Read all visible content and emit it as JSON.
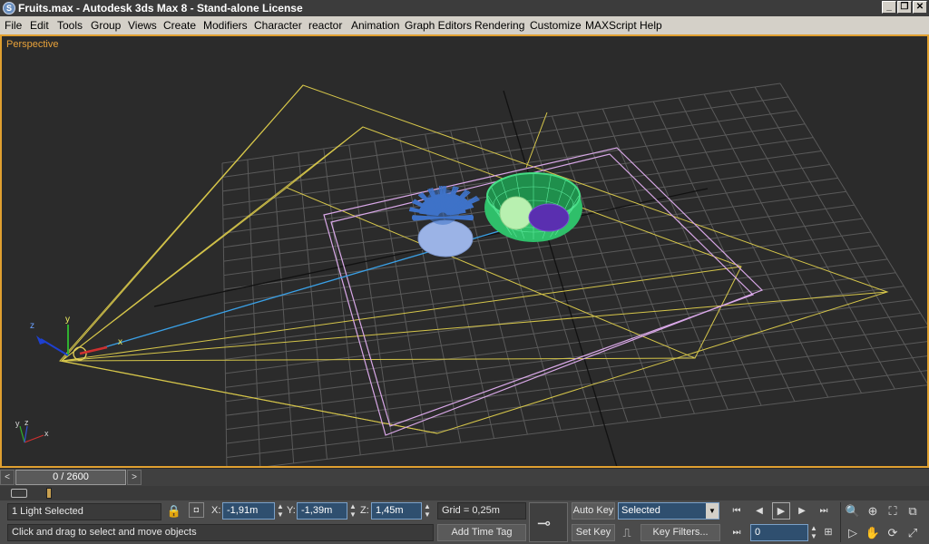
{
  "window": {
    "title": "Fruits.max - Autodesk 3ds Max 8  - Stand-alone License",
    "app_icon": "3ds-max-icon",
    "buttons": {
      "minimize": "_",
      "restore": "❐",
      "close": "✕"
    }
  },
  "menu": {
    "items": [
      "File",
      "Edit",
      "Tools",
      "Group",
      "Views",
      "Create",
      "Modifiers",
      "Character",
      "reactor",
      "Animation",
      "Graph Editors",
      "Rendering",
      "Customize",
      "MAXScript",
      "Help"
    ]
  },
  "viewport": {
    "label": "Perspective",
    "gizmo": {
      "x": "x",
      "y": "y",
      "z": "z"
    },
    "corner_axes": {
      "x": "x",
      "y": "y",
      "z": "z"
    },
    "colors": {
      "grid": "#5a5a5a",
      "light_cone": "#d6c64a",
      "target_plane": "#d9a8e8",
      "bowl": "#2fbf6a",
      "plant": "#3e72c8",
      "pot": "#9bb3e6",
      "light_line": "#3aa0e6",
      "label": "#e8a23a",
      "border": "#e0a030"
    }
  },
  "time_slider": {
    "prev": "<",
    "position": "0 / 2600",
    "next": ">"
  },
  "status": {
    "selection": "1 Light Selected",
    "prompt": "Click and drag to select and move objects",
    "coords": {
      "x_label": "X:",
      "x_value": "-1,91m",
      "y_label": "Y:",
      "y_value": "-1,39m",
      "z_label": "Z:",
      "z_value": "1,45m"
    },
    "grid": "Grid = 0,25m",
    "add_time_tag": "Add Time Tag",
    "auto_key": "Auto Key",
    "set_key": "Set Key",
    "key_mode": "Selected",
    "key_filters": "Key Filters...",
    "frame": "0"
  }
}
